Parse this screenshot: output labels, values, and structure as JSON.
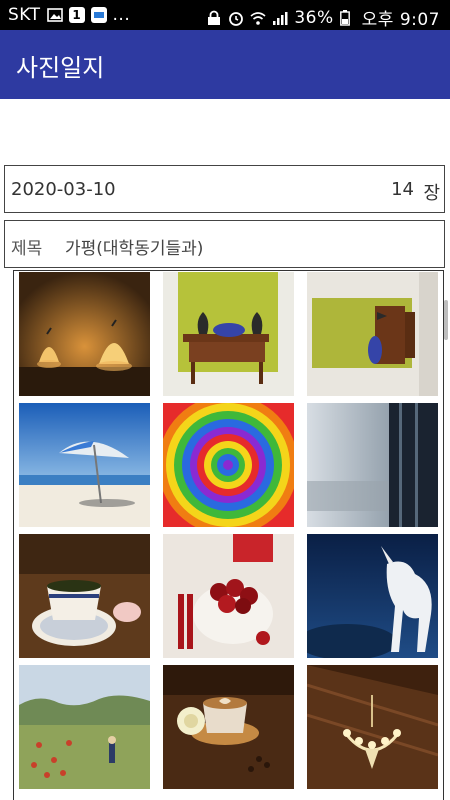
{
  "status_bar": {
    "carrier": "SKT",
    "badge": "1",
    "more": "...",
    "battery": "36%",
    "time": "오후 9:07"
  },
  "app_bar": {
    "title": "사진일지"
  },
  "entry": {
    "date": "2020-03-10",
    "count": "14",
    "count_unit": "장",
    "title_label": "제목",
    "title_value": "가평(대학동기들과)"
  },
  "photos": [
    {
      "icon": "lamps-photo"
    },
    {
      "icon": "console-table-photo"
    },
    {
      "icon": "rotated-console-photo"
    },
    {
      "icon": "beach-umbrella-photo"
    },
    {
      "icon": "psychedelic-spiral-photo"
    },
    {
      "icon": "window-sky-photo"
    },
    {
      "icon": "teacup-photo"
    },
    {
      "icon": "cherries-bowl-photo"
    },
    {
      "icon": "unicorn-moon-photo"
    },
    {
      "icon": "poppy-field-painting-photo"
    },
    {
      "icon": "coffee-rose-photo"
    },
    {
      "icon": "chandelier-photo"
    }
  ],
  "colors": {
    "app_bar": "#2e3aa1",
    "status_bar": "#000000"
  }
}
